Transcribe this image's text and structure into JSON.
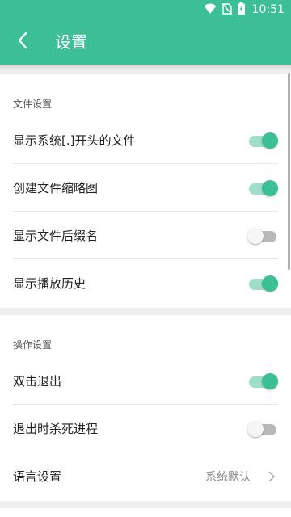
{
  "status_bar": {
    "time": "10:51",
    "icons": [
      "wifi-icon",
      "no-sim-icon",
      "battery-charging-icon"
    ]
  },
  "app_bar": {
    "title": "设置",
    "back_icon": "back-arrow-icon"
  },
  "sections": [
    {
      "header": "文件设置",
      "items": [
        {
          "label": "显示系统[.]开头的文件",
          "type": "switch",
          "on": true
        },
        {
          "label": "创建文件缩略图",
          "type": "switch",
          "on": true
        },
        {
          "label": "显示文件后缀名",
          "type": "switch",
          "on": false
        },
        {
          "label": "显示播放历史",
          "type": "switch",
          "on": true
        }
      ]
    },
    {
      "header": "操作设置",
      "items": [
        {
          "label": "双击退出",
          "type": "switch",
          "on": true
        },
        {
          "label": "退出时杀死进程",
          "type": "switch",
          "on": false
        },
        {
          "label": "语言设置",
          "type": "select",
          "value": "系统默认"
        }
      ]
    }
  ],
  "colors": {
    "accent": "#3cbf94",
    "accent_light": "#9fdec9",
    "switch_off_track": "#b9b9b9",
    "background": "#efefef"
  }
}
